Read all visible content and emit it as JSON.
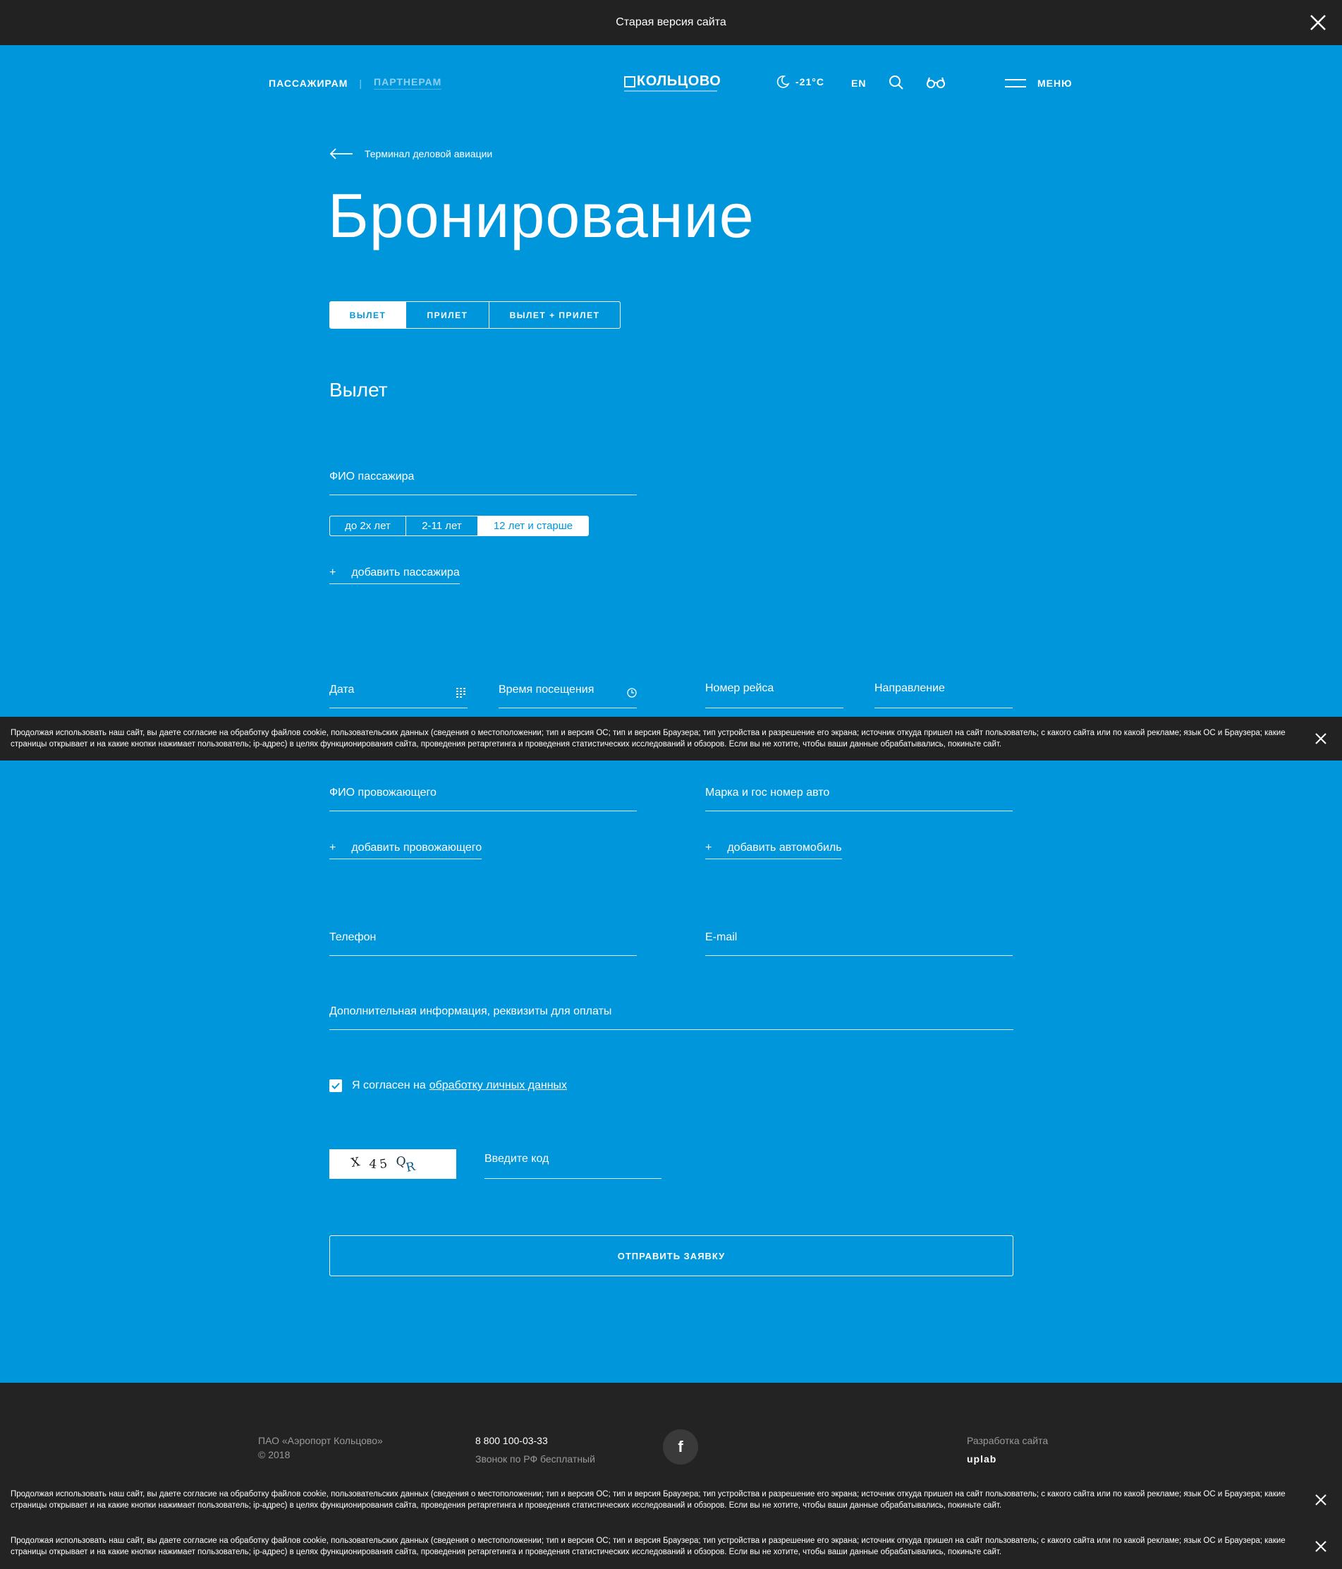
{
  "topbar": {
    "text": "Старая версия сайта"
  },
  "header": {
    "nav_passengers": "ПАССАЖИРАМ",
    "nav_separator": "|",
    "nav_partners": "ПАРТНЕРАМ",
    "logo": "КОЛЬЦОВО",
    "temperature": "-21°C",
    "lang": "EN",
    "menu": "МЕНЮ"
  },
  "breadcrumb": {
    "back_label": "Терминал деловой авиации"
  },
  "page_title": "Бронирование",
  "tabs": [
    {
      "label": "ВЫЛЕТ",
      "active": true
    },
    {
      "label": "ПРИЛЕТ",
      "active": false
    },
    {
      "label": "ВЫЛЕТ + ПРИЛЕТ",
      "active": false
    }
  ],
  "section_title": "Вылет",
  "form": {
    "passenger_name": "ФИО пассажира",
    "age_options": [
      {
        "label": "до 2х лет",
        "active": false
      },
      {
        "label": "2-11 лет",
        "active": false
      },
      {
        "label": "12 лет и старше",
        "active": true
      }
    ],
    "add_passenger": "добавить пассажира",
    "plus": "+",
    "date": "Дата",
    "visit_time": "Время посещения",
    "flight_number": "Номер рейса",
    "direction": "Направление",
    "escort_name": "ФИО провожающего",
    "car": "Марка и гос номер авто",
    "add_escort": "добавить провожающего",
    "add_car": "добавить автомобиль",
    "phone": "Телефон",
    "email": "E-mail",
    "extra_info": "Дополнительная информация, реквизиты для оплаты",
    "agree_text": "Я согласен на",
    "agree_link": "обработку личных данных",
    "agree_checked": true,
    "captcha_text": "X 4 5 Q R",
    "captcha_input": "Введите код",
    "submit": "ОТПРАВИТЬ ЗАЯВКУ"
  },
  "cookie": {
    "text": "Продолжая использовать наш сайт, вы даете согласие на обработку файлов cookie, пользовательских данных (сведения о местоположении; тип и версия ОС; тип и версия Браузера; тип устройства и разрешение его экрана; источник откуда пришел на сайт пользователь; с какого сайта или по какой рекламе; язык ОС и Браузера; какие страницы открывает и на какие кнопки нажимает пользователь; ip-адрес) в целях функционирования сайта, проведения ретаргетинга и проведения статистических исследований и обзоров. Если вы не хотите, чтобы ваши данные обрабатывались, покиньте сайт."
  },
  "footer": {
    "company": "ПАО «Аэропорт Кольцово»",
    "copyright": "© 2018",
    "phone": "8 800 100-03-33",
    "phone_note": "Звонок по РФ бесплатный",
    "facebook": "f",
    "dev_label": "Разработка сайта",
    "dev_brand": "uplab"
  },
  "colors": {
    "background": "#0096dc",
    "dark": "#222222",
    "white": "#ffffff"
  }
}
